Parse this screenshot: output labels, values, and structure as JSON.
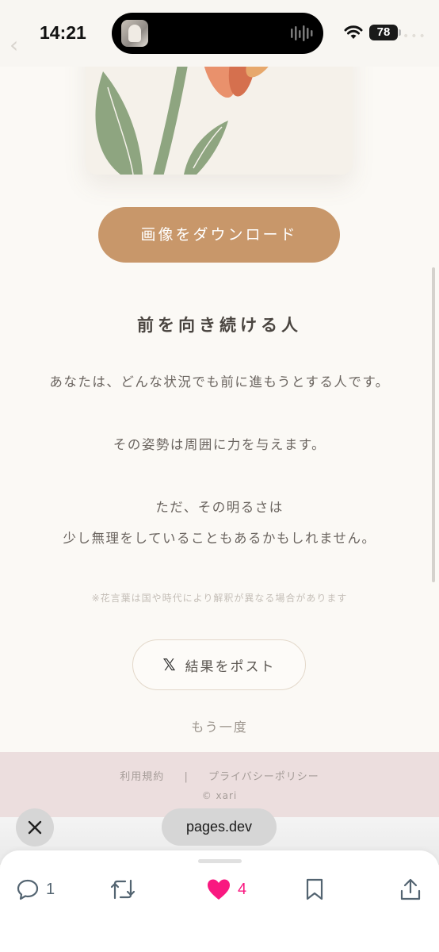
{
  "status_bar": {
    "time": "14:21",
    "battery": "78"
  },
  "result": {
    "download_label": "画像をダウンロード",
    "title": "前を向き続ける人",
    "description": [
      "あなたは、どんな状況でも前に進もうとする人です。",
      "その姿勢は周囲に力を与えます。",
      "ただ、その明るさは",
      "少し無理をしていることもあるかもしれません。"
    ],
    "note": "※花言葉は国や時代により解釈が異なる場合があります",
    "post_label": "結果をポスト",
    "retry_label": "もう一度"
  },
  "footer": {
    "terms": "利用規約",
    "separator": "|",
    "privacy": "プライバシーポリシー",
    "copyright": "© xari"
  },
  "browser": {
    "url": "pages.dev"
  },
  "actions": {
    "reply_count": "1",
    "like_count": "4"
  },
  "colors": {
    "accent": "#c8976a",
    "background": "#fbf9f5",
    "footer": "#ecdede",
    "like": "#f91880",
    "leaf": "#8ea580"
  },
  "icons": [
    "wifi-icon",
    "battery-icon",
    "x-logo-icon",
    "close-icon",
    "reply-icon",
    "repost-icon",
    "heart-icon",
    "bookmark-icon",
    "share-icon"
  ]
}
